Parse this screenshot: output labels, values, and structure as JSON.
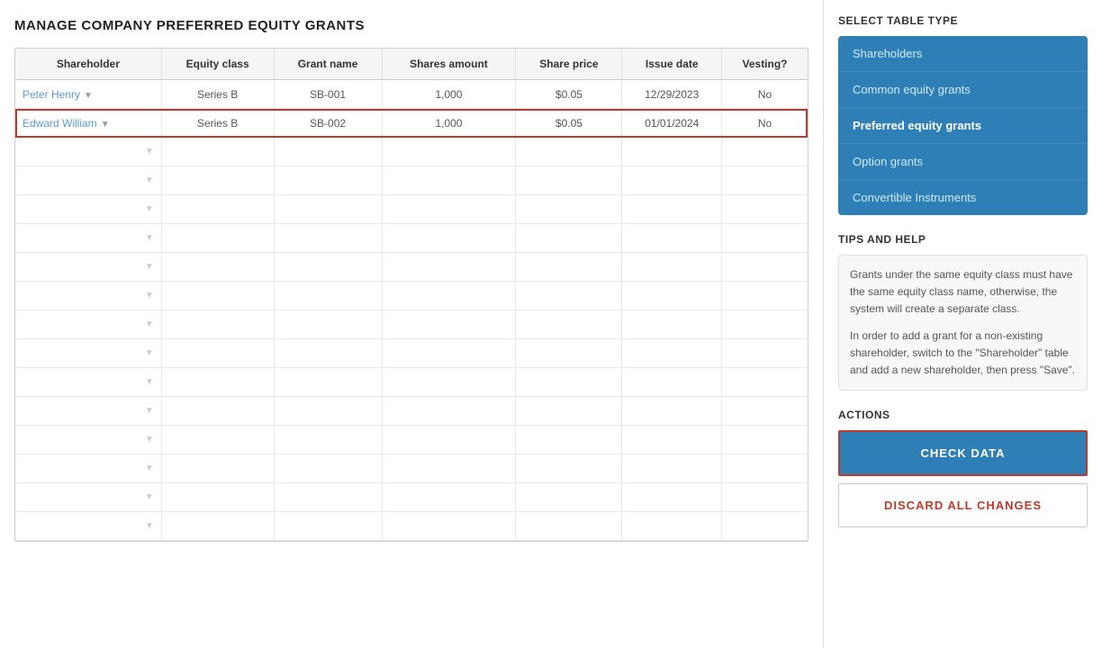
{
  "page": {
    "title": "MANAGE COMPANY PREFERRED EQUITY GRANTS"
  },
  "table": {
    "columns": [
      "Shareholder",
      "Equity class",
      "Grant name",
      "Shares amount",
      "Share price",
      "Issue date",
      "Vesting?"
    ],
    "rows": [
      {
        "shareholder": "Peter Henry",
        "equity_class": "Series B",
        "grant_name": "SB-001",
        "shares_amount": "1,000",
        "share_price": "$0.05",
        "issue_date": "12/29/2023",
        "vesting": "No",
        "highlighted": false
      },
      {
        "shareholder": "Edward William",
        "equity_class": "Series B",
        "grant_name": "SB-002",
        "shares_amount": "1,000",
        "share_price": "$0.05",
        "issue_date": "01/01/2024",
        "vesting": "No",
        "highlighted": true
      }
    ],
    "empty_rows": 14
  },
  "sidebar": {
    "select_table_title": "SELECT TABLE TYPE",
    "table_types": [
      {
        "label": "Shareholders",
        "active": false
      },
      {
        "label": "Common equity grants",
        "active": false
      },
      {
        "label": "Preferred equity grants",
        "active": true
      },
      {
        "label": "Option grants",
        "active": false
      },
      {
        "label": "Convertible Instruments",
        "active": false
      }
    ],
    "tips_title": "TIPS AND HELP",
    "tips_text_1": "Grants under the same equity class must have the same equity class name, otherwise, the system will create a separate class.",
    "tips_text_2": "In order to add a grant for a non-existing shareholder, switch to the \"Shareholder\" table and add a new shareholder, then press \"Save\".",
    "actions_title": "ACTIONS",
    "check_data_label": "CHECK DATA",
    "discard_label": "DISCARD ALL CHANGES"
  }
}
